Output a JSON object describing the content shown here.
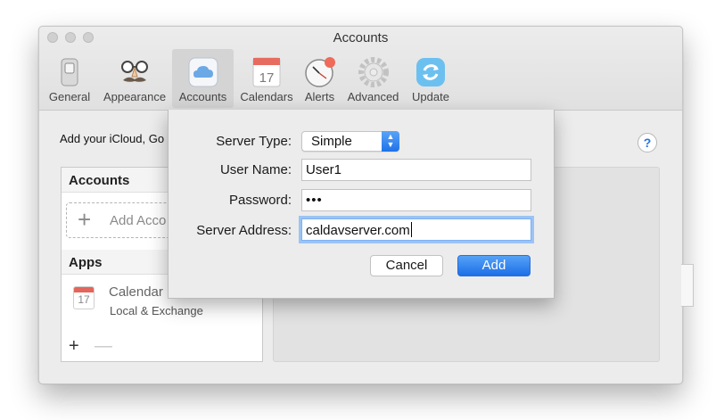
{
  "window": {
    "title": "Accounts"
  },
  "toolbar": {
    "items": [
      {
        "label": "General",
        "icon": "switch-icon"
      },
      {
        "label": "Appearance",
        "icon": "disguise-icon"
      },
      {
        "label": "Accounts",
        "icon": "cloud-icon",
        "active": true
      },
      {
        "label": "Calendars",
        "icon": "calendar-icon"
      },
      {
        "label": "Alerts",
        "icon": "clock-icon"
      },
      {
        "label": "Advanced",
        "icon": "gear-icon"
      },
      {
        "label": "Update",
        "icon": "refresh-icon"
      }
    ],
    "calendar_day": "17"
  },
  "content": {
    "intro_text": "Add your iCloud, Go",
    "help_label": "?",
    "accounts_header": "Accounts",
    "add_account_label": "Add Acco",
    "apps_header": "Apps",
    "app": {
      "name": "Calendar",
      "subtitle": "Local & Exchange",
      "day": "17"
    },
    "footer_add": "+",
    "footer_remove": "—"
  },
  "sheet": {
    "server_type_label": "Server Type:",
    "server_type_value": "Simple",
    "user_name_label": "User Name:",
    "user_name_value": "User1",
    "password_label": "Password:",
    "password_value": "•••",
    "server_address_label": "Server Address:",
    "server_address_value": "caldavserver.com",
    "cancel_label": "Cancel",
    "add_label": "Add"
  },
  "colors": {
    "accent": "#1d6fe6",
    "active_tab": "#d4d4d4",
    "alert_badge": "#f06a5a"
  }
}
